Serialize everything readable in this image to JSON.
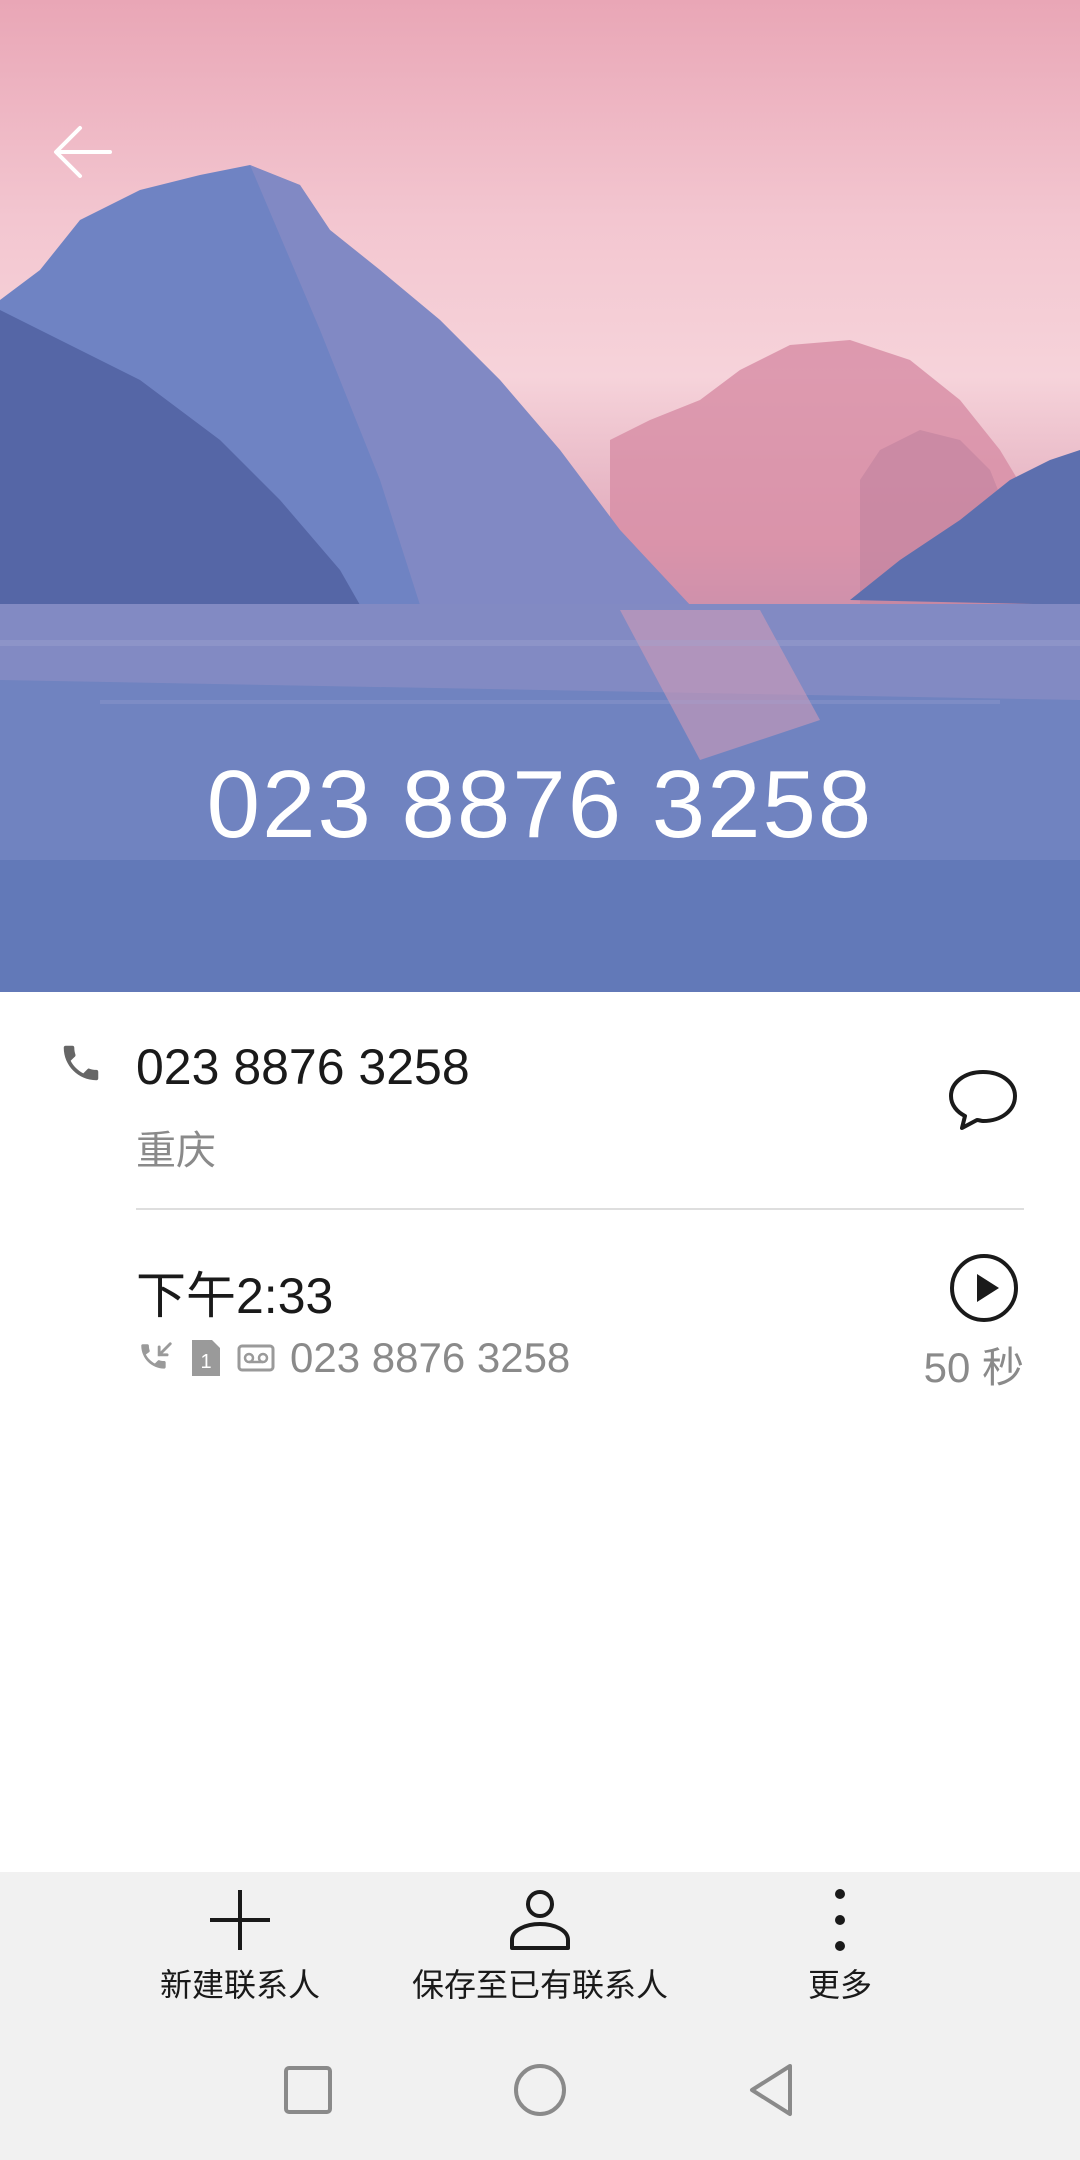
{
  "header": {
    "back_icon": "arrow-left-icon",
    "title_number": "023 8876 3258"
  },
  "contact": {
    "number": "023 8876 3258",
    "location": "重庆",
    "phone_icon": "phone-icon",
    "message_icon": "chat-bubble-icon"
  },
  "call_record": {
    "time": "下午2:33",
    "direction_icon": "incoming-call-icon",
    "sim_icon": "sim-1-icon",
    "sim_label": "1",
    "voicemail_icon": "voicemail-icon",
    "number": "023 8876 3258",
    "play_icon": "play-icon",
    "duration": "50 秒"
  },
  "actions": [
    {
      "label": "新建联系人",
      "icon": "plus-icon"
    },
    {
      "label": "保存至已有联系人",
      "icon": "person-icon"
    },
    {
      "label": "更多",
      "icon": "more-vertical-icon"
    }
  ],
  "nav": {
    "recent_icon": "square-icon",
    "home_icon": "circle-icon",
    "back_icon": "triangle-back-icon"
  },
  "colors": {
    "hero_sky": "#f3c6d0",
    "hero_water": "#6c80bc",
    "bar_bg": "#f1f1f1",
    "secondary_text": "#8a8a8a"
  }
}
